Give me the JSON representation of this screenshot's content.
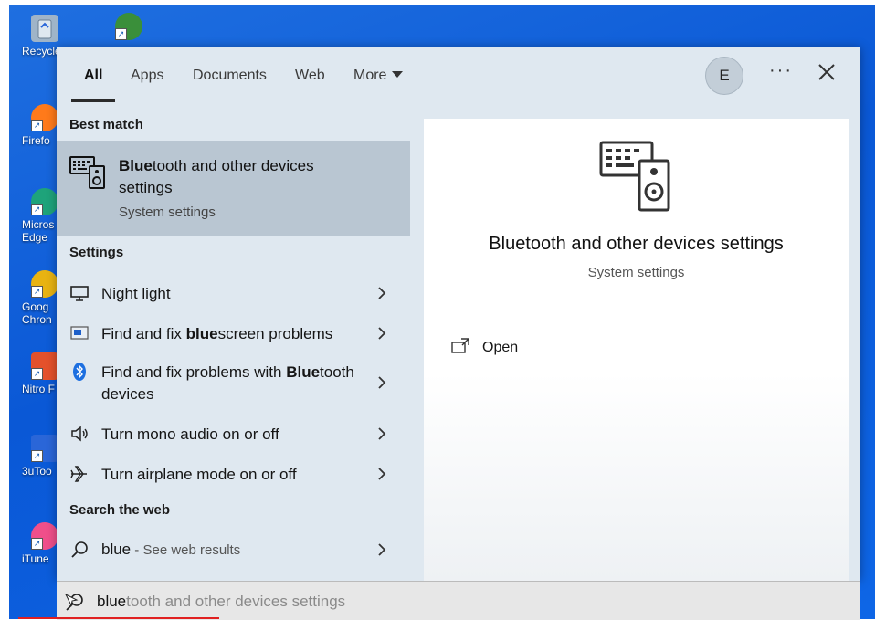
{
  "desktop_icons": [
    {
      "label": "Recycle",
      "color": "#9fb4c8"
    },
    {
      "label": "",
      "color": "#3a8f3a"
    },
    {
      "label": "Firefo",
      "color": "#ff7a1a"
    },
    {
      "label": "Micros Edge",
      "color": "#1ea37a"
    },
    {
      "label": "Goog Chron",
      "color": "#e8b312"
    },
    {
      "label": "Nitro F",
      "color": "#e4512b"
    },
    {
      "label": "3uToo",
      "color": "#2a66d8"
    },
    {
      "label": "iTune",
      "color": "#f04f8a"
    }
  ],
  "tabs": [
    {
      "label": "All",
      "active": true
    },
    {
      "label": "Apps"
    },
    {
      "label": "Documents"
    },
    {
      "label": "Web"
    },
    {
      "label": "More"
    }
  ],
  "account": {
    "initial": "E"
  },
  "header": {
    "more_dots": "···"
  },
  "sections": {
    "best_match": "Best match",
    "settings": "Settings",
    "search_web": "Search the web"
  },
  "best_match": {
    "title_bold": "Blue",
    "title_rest": "tooth and other devices settings",
    "subtitle": "System settings"
  },
  "settings_items": [
    {
      "pre": "Night light",
      "bold": "",
      "post": "",
      "icon": "monitor-icon"
    },
    {
      "pre": "Find and fix ",
      "bold": "blue",
      "post": "screen problems",
      "icon": "bluescreen-icon"
    },
    {
      "pre": "Find and fix problems with ",
      "bold": "Blue",
      "post": "tooth devices",
      "icon": "bluetooth-icon"
    },
    {
      "pre": "Turn mono audio on or off",
      "bold": "",
      "post": "",
      "icon": "speaker-icon"
    },
    {
      "pre": "Turn airplane mode on or off",
      "bold": "",
      "post": "",
      "icon": "airplane-icon"
    }
  ],
  "web_item": {
    "query": "blue",
    "suffix": " - See web results"
  },
  "preview": {
    "title": "Bluetooth and other devices settings",
    "subtitle": "System settings",
    "open_label": "Open"
  },
  "searchbar": {
    "typed": "blue",
    "ghost": "tooth and other devices settings"
  },
  "colors": {
    "panel_bg": "#dfe8f0",
    "best_match_bg": "#b9c6d2",
    "desktop_blue": "#0a58d6"
  }
}
